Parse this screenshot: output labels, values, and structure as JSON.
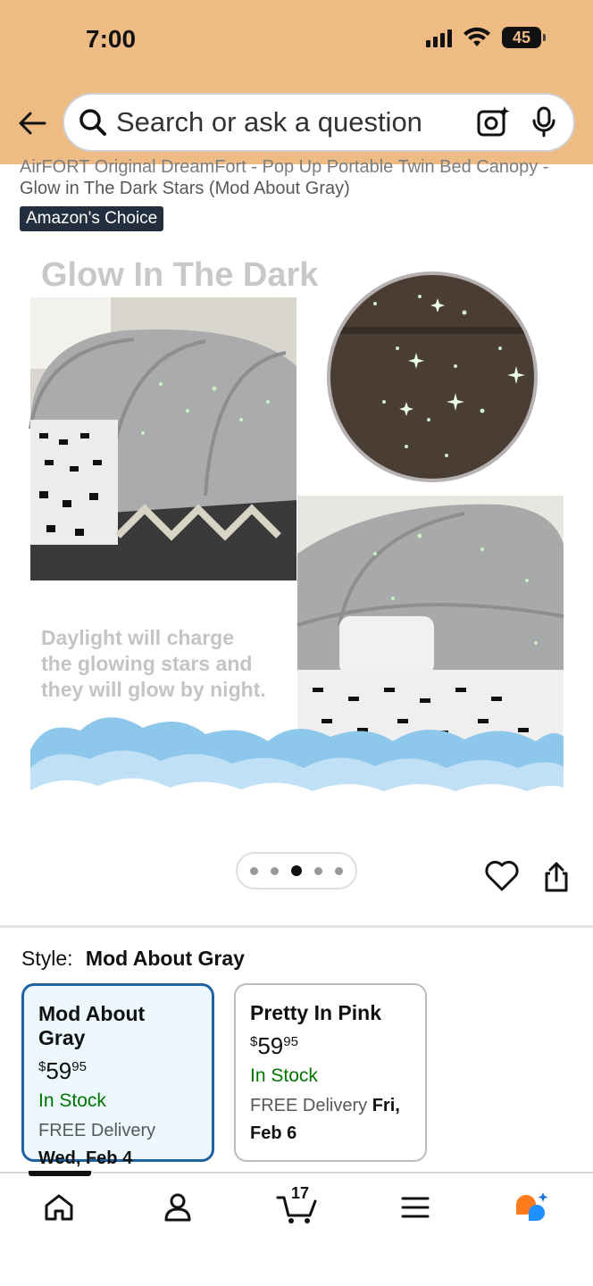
{
  "status_bar": {
    "time": "7:00",
    "battery": "45"
  },
  "search": {
    "placeholder": "Search or ask a question"
  },
  "product": {
    "title_line1": "AirFORT Original DreamFort - Pop Up Portable Twin Bed Canopy -",
    "title_line2": "Glow in The Dark Stars (Mod About Gray)",
    "badge": "Amazon's Choice"
  },
  "hero_image": {
    "heading": "Glow In The Dark",
    "caption_lines": [
      "Daylight will charge",
      "the glowing stars and",
      "they will glow by night."
    ],
    "dots_total": 5,
    "active_dot": 3
  },
  "style": {
    "label": "Style:",
    "selected": "Mod About Gray",
    "options": [
      {
        "name": "Mod About Gray",
        "price_whole": "59",
        "price_cents": "95",
        "currency": "$",
        "stock": "In Stock",
        "delivery_prefix": "FREE Delivery",
        "delivery_date": "Wed, Feb 4"
      },
      {
        "name": "Pretty In Pink",
        "price_whole": "59",
        "price_cents": "95",
        "currency": "$",
        "stock": "In Stock",
        "delivery_prefix": "FREE Delivery",
        "delivery_date": "Fri, Feb 6"
      }
    ]
  },
  "tabbar": {
    "cart_count": "17"
  },
  "colors": {
    "header": "#efbb84",
    "selected_border": "#2162a1",
    "in_stock": "#007600",
    "badge_bg": "#232f3e"
  }
}
